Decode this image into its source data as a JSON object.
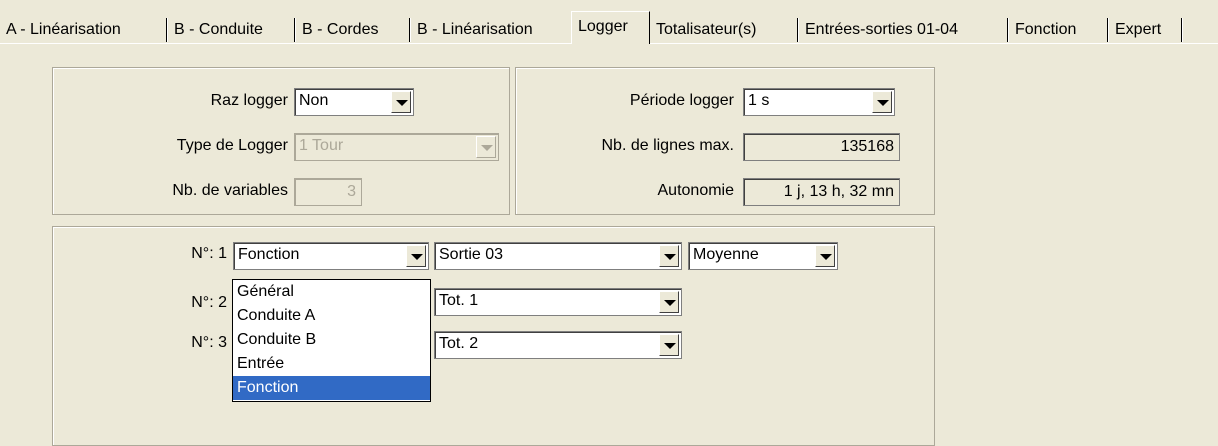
{
  "tabs": [
    "A - Linéarisation",
    "B - Conduite",
    "B - Cordes",
    "B - Linéarisation",
    "Logger",
    "Totalisateur(s)",
    "Entrées-sorties 01-04",
    "Fonction",
    "Expert"
  ],
  "active_tab": "Logger",
  "left_group": {
    "raz_logger_label": "Raz logger",
    "raz_logger_value": "Non",
    "type_logger_label": "Type de Logger",
    "type_logger_value": "1 Tour",
    "nb_variables_label": "Nb. de variables",
    "nb_variables_value": "3"
  },
  "right_group": {
    "periode_label": "Période logger",
    "periode_value": "1 s",
    "nb_lignes_label": "Nb. de lignes max.",
    "nb_lignes_value": "135168",
    "autonomie_label": "Autonomie",
    "autonomie_value": "1 j, 13 h, 32 mn"
  },
  "variables": [
    {
      "label": "N°:  1",
      "source": "Fonction",
      "output": "Sortie 03",
      "mode": "Moyenne"
    },
    {
      "label": "N°:  2",
      "source": "",
      "output": "Tot. 1"
    },
    {
      "label": "N°:  3",
      "source": "",
      "output": "Tot. 2"
    }
  ],
  "dropdown_options": [
    "Général",
    "Conduite A",
    "Conduite B",
    "Entrée",
    "Fonction"
  ],
  "dropdown_selected": "Fonction",
  "colors": {
    "background": "#ece9d8",
    "selection": "#316ac5",
    "disabled_text": "#aca899"
  }
}
